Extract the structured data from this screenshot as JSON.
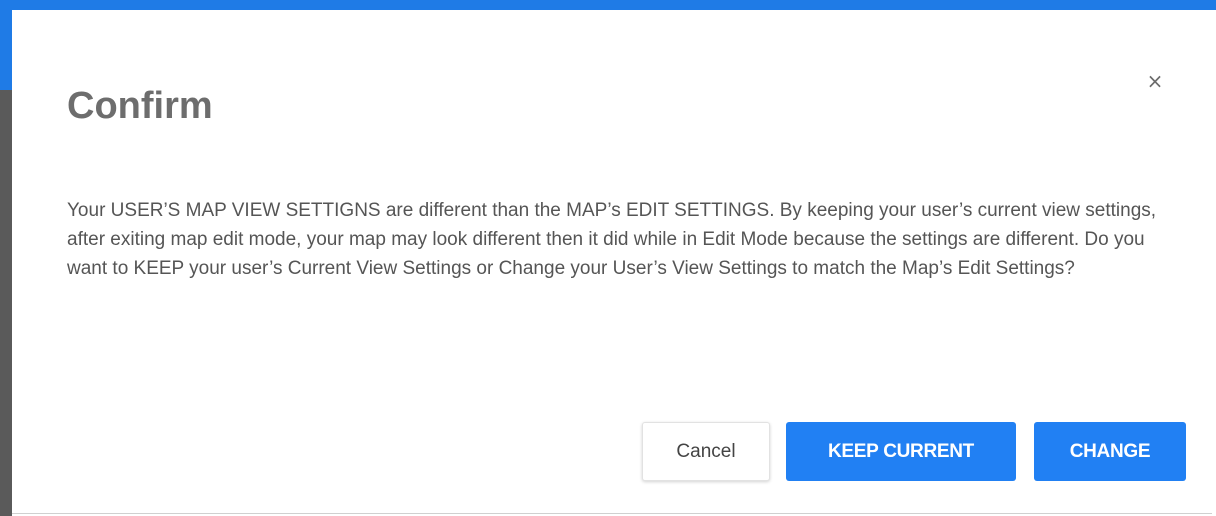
{
  "dialog": {
    "title": "Confirm",
    "close_symbol": "×",
    "close_icon": "close-icon",
    "message": "Your USER’S MAP VIEW SETTIGNS are different than the MAP’s EDIT SETTINGS. By keeping your user’s current view settings, after exiting map edit mode, your map may look different then it did while in Edit Mode because the settings are different. Do you want to KEEP your user’s Current View Settings or Change your User’s View Settings to match the Map’s Edit Settings?"
  },
  "buttons": {
    "cancel_label": "Cancel",
    "keep_label": "KEEP CURRENT",
    "change_label": "CHANGE"
  },
  "colors": {
    "primary": "#2180f3",
    "backdrop_accent": "#1f7be6",
    "title_text": "#6d6d6d",
    "body_text": "#555555"
  }
}
